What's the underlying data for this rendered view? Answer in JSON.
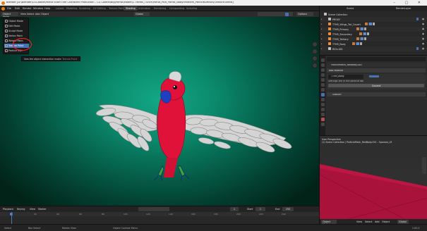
{
  "window": {
    "title": "Blender [D:\\Blender\\CGCookie\\Parrot Short Film Character Production - CG Cookie\\Big\\Parrot\\Model\\1. Parrot_TShirt\\Parrot_PBR_Parrot_BodyFeathers_ParticleDensity\\Texture.blend]"
  },
  "menu": {
    "items": [
      "File",
      "Edit",
      "Render",
      "Window",
      "Help"
    ]
  },
  "workspaces": {
    "tabs": [
      "Layout",
      "Modeling",
      "Sculpting",
      "UV Editing",
      "Texture Paint",
      "Shading",
      "Animation",
      "Rendering",
      "Compositing",
      "Scripting"
    ],
    "active": "Shading"
  },
  "topright": {
    "scene": "Scene",
    "view_layer": "RenderLayer"
  },
  "viewport_header": {
    "mode": "Object Mode",
    "view": "View",
    "select": "Select",
    "add": "Add",
    "object": "Object",
    "orientation": "Global",
    "options": "Options"
  },
  "mode_menu": {
    "items": [
      "Object Mode",
      "Edit Mode",
      "Sculpt Mode",
      "Vertex Paint",
      "Weight Paint",
      "Texture Paint",
      "Particle Edit"
    ],
    "selected": "Texture Paint"
  },
  "tooltip": {
    "text": "Sets the object interaction mode:",
    "value": "Texture Paint"
  },
  "outliner": {
    "title": "Scene Collection",
    "rows": [
      {
        "label": "PROXY",
        "type": "collection"
      },
      {
        "label": "TTHR_Wings_Tail_Covert",
        "type": "object"
      },
      {
        "label": "TTHR_Primary",
        "type": "object"
      },
      {
        "label": "TTHR_Secondary",
        "type": "object"
      },
      {
        "label": "TTHR_Tertiary",
        "type": "object"
      },
      {
        "label": "TTHR_Body",
        "type": "object"
      },
      {
        "label": "RIGs.001",
        "type": "collection"
      }
    ]
  },
  "properties": {
    "object_name": "ParticleMesh_RedBody.001",
    "add_modifier": "Add Modifier",
    "modifier_name": "TTHR_body",
    "settings_note": "Settings are in the particle tab",
    "convert": "Convert",
    "subsurf": "Subsurf"
  },
  "preview": {
    "view": "User Perspective",
    "path": "(1) Scene Collection | ParticleMesh_RedBody.001 : Sparrow_LR",
    "mode": "Object Mode",
    "menus": [
      "View",
      "Select",
      "Add",
      "Object"
    ],
    "shading": "Global"
  },
  "timeline": {
    "menus": [
      "Playback",
      "Keying",
      "View",
      "Marker"
    ],
    "current_frame": "1",
    "start_label": "Start",
    "start": "1",
    "end_label": "End",
    "end": "250",
    "ticks": [
      "0",
      "20",
      "40",
      "60",
      "80",
      "100",
      "120",
      "140",
      "160",
      "180",
      "200",
      "220",
      "240"
    ]
  },
  "status": {
    "left": "Select",
    "mid": "Box Select",
    "mid2": "Rotate View",
    "right": "Object Context Menu",
    "stats": "2.83.0"
  },
  "colors": {
    "accent": "#4772b3",
    "viewport_bg": "#0b8a6c",
    "parrot_red": "#e1123a",
    "highlight": "#ff2020"
  }
}
